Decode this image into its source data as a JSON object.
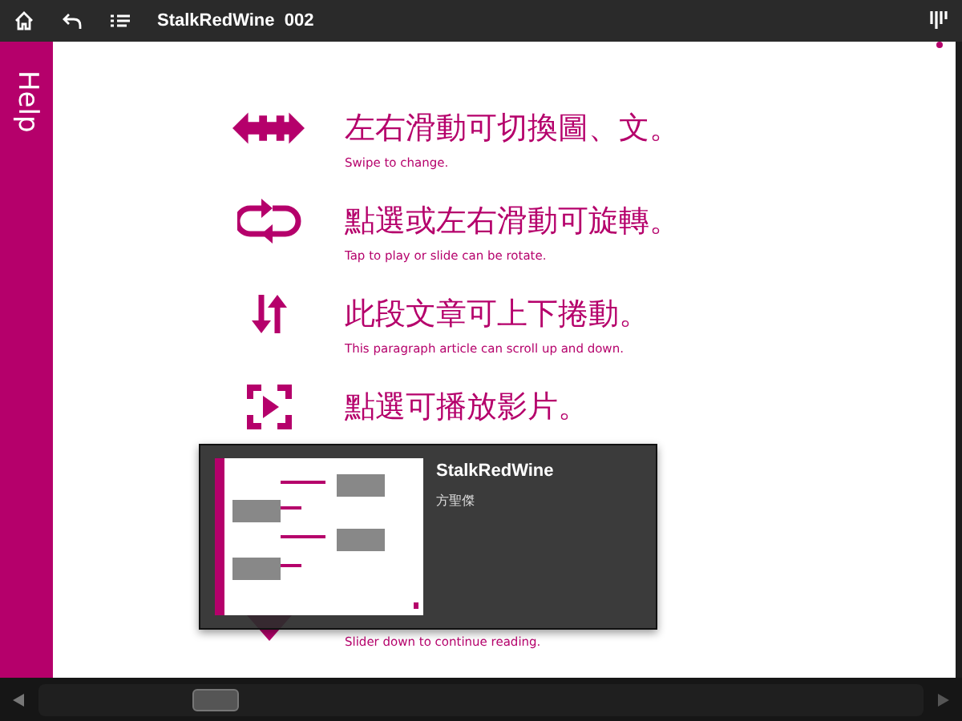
{
  "top_bar": {
    "title": "StalkRedWine  002"
  },
  "sidebar": {
    "label": "Help"
  },
  "rows": [
    {
      "kind": "swipe",
      "title": "左右滑動可切換圖、文。",
      "subtitle": "Swipe to change."
    },
    {
      "kind": "rotate",
      "title": "點選或左右滑動可旋轉。",
      "subtitle": "Tap to play or slide can be rotate."
    },
    {
      "kind": "scroll",
      "title": "此段文章可上下捲動。",
      "subtitle": "This paragraph article can scroll up and down."
    },
    {
      "kind": "video",
      "title": "點選可播放影片。"
    },
    {
      "kind": "down",
      "subtitle": "Slider down to continue reading."
    }
  ],
  "popup": {
    "title": "StalkRedWine",
    "author": "方聖傑"
  },
  "page_slider": {
    "level": 0.2
  }
}
